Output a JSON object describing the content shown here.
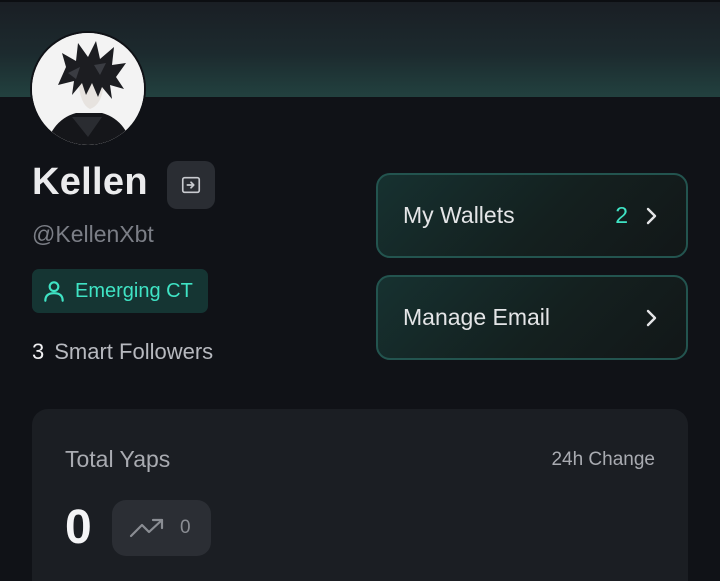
{
  "profile": {
    "name": "Kellen",
    "handle": "@KellenXbt",
    "badge_label": "Emerging CT",
    "smart_followers_count": "3",
    "smart_followers_label": "Smart Followers"
  },
  "actions": {
    "wallets_label": "My Wallets",
    "wallets_count": "2",
    "email_label": "Manage Email"
  },
  "stats": {
    "total_yaps_label": "Total Yaps",
    "total_yaps_value": "0",
    "change_label": "24h Change",
    "change_value": "0"
  },
  "colors": {
    "accent": "#3fe3c4",
    "background": "#101217",
    "card": "#1b1e23"
  },
  "icons": {
    "logout": "logout-icon",
    "badge": "user-icon",
    "chevron": "chevron-right-icon",
    "trend": "trending-up-icon"
  }
}
